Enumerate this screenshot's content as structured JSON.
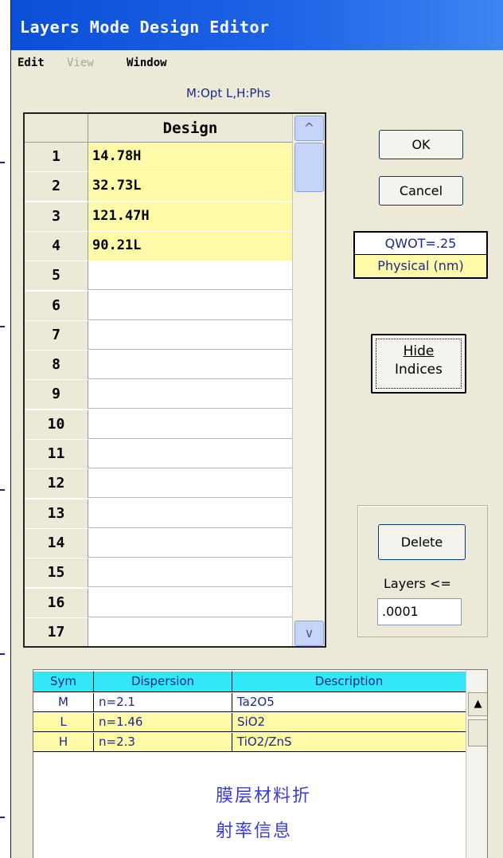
{
  "window": {
    "title": "Layers Mode Design Editor"
  },
  "menu": {
    "edit": "Edit",
    "view": "View",
    "window": "Window"
  },
  "mode_label": "M:Opt  L,H:Phs",
  "grid": {
    "header": "Design",
    "rows": [
      {
        "num": "1",
        "value": "14.78H"
      },
      {
        "num": "2",
        "value": "32.73L"
      },
      {
        "num": "3",
        "value": "121.47H"
      },
      {
        "num": "4",
        "value": "90.21L"
      },
      {
        "num": "5",
        "value": ""
      },
      {
        "num": "6",
        "value": ""
      },
      {
        "num": "7",
        "value": ""
      },
      {
        "num": "8",
        "value": ""
      },
      {
        "num": "9",
        "value": ""
      },
      {
        "num": "10",
        "value": ""
      },
      {
        "num": "11",
        "value": ""
      },
      {
        "num": "12",
        "value": ""
      },
      {
        "num": "13",
        "value": ""
      },
      {
        "num": "14",
        "value": ""
      },
      {
        "num": "15",
        "value": ""
      },
      {
        "num": "16",
        "value": ""
      },
      {
        "num": "17",
        "value": ""
      }
    ]
  },
  "buttons": {
    "ok": "OK",
    "cancel": "Cancel",
    "hide_line1": "Hide",
    "hide_line2": "Indices",
    "delete": "Delete"
  },
  "units": {
    "qwot": "QWOT=.25",
    "physical": "Physical (nm)"
  },
  "layers_label": "Layers <=",
  "threshold_value": ".0001",
  "materials": {
    "headers": [
      "Sym",
      "Dispersion",
      "Description"
    ],
    "rows": [
      {
        "sym": "M",
        "dispersion": "n=2.1",
        "description": "Ta2O5",
        "color": "#ffffff"
      },
      {
        "sym": "L",
        "dispersion": "n=1.46",
        "description": "SiO2",
        "color": "#fffaa8"
      },
      {
        "sym": "H",
        "dispersion": "n=2.3",
        "description": "TiO2/ZnS",
        "color": "#fffaa8"
      }
    ]
  },
  "annotation": {
    "line1": "膜层材料折",
    "line2": "射率信息"
  },
  "colors": {
    "filled_cell": "#fffaa8",
    "header_cyan": "#33e6f8",
    "label_blue": "#1c2a8c",
    "annotation_blue": "#3a3bd6"
  }
}
